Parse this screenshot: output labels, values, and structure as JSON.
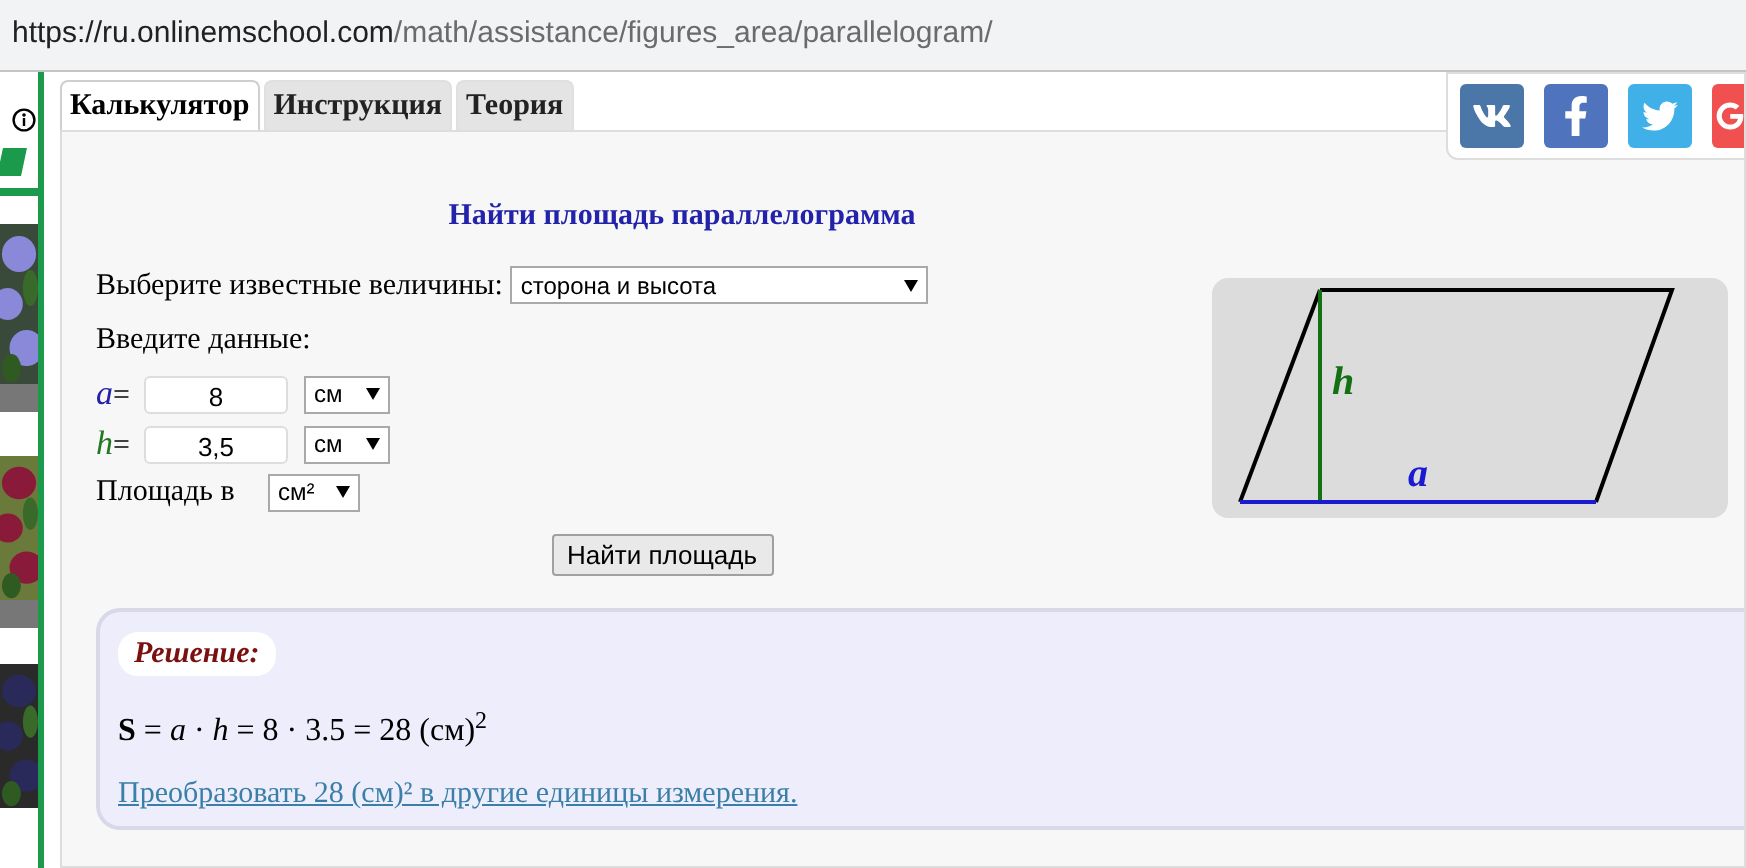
{
  "address_bar": {
    "url_host": "https://ru.onlinemschool.com",
    "url_path": "/math/assistance/figures_area/parallelogram/"
  },
  "tabs": [
    {
      "label": "Калькулятор",
      "selected": true
    },
    {
      "label": "Инструкция",
      "selected": false
    },
    {
      "label": "Теория",
      "selected": false
    }
  ],
  "calculator": {
    "title": "Найти площадь параллелограмма",
    "known_label": "Выберите известные величины:",
    "known_value": "сторона и высота",
    "enter_label": "Введите данные:",
    "inputs": [
      {
        "symbol": "a",
        "equals": "=",
        "color": "#2222aa",
        "value": "8",
        "unit": "см"
      },
      {
        "symbol": "h",
        "equals": "=",
        "color": "#227722",
        "value": "3,5",
        "unit": "см"
      }
    ],
    "area_label": "Площадь в",
    "area_unit": "см²",
    "button": "Найти площадь"
  },
  "diagram": {
    "height_label": "h",
    "base_label": "a"
  },
  "solution": {
    "heading": "Решение:",
    "formula": "**S** = *a* · *h* = 8 · 3.5 = 28 (см)$^{2}$",
    "link": "Преобразовать 28 (см)² в другие единицы измерения."
  }
}
